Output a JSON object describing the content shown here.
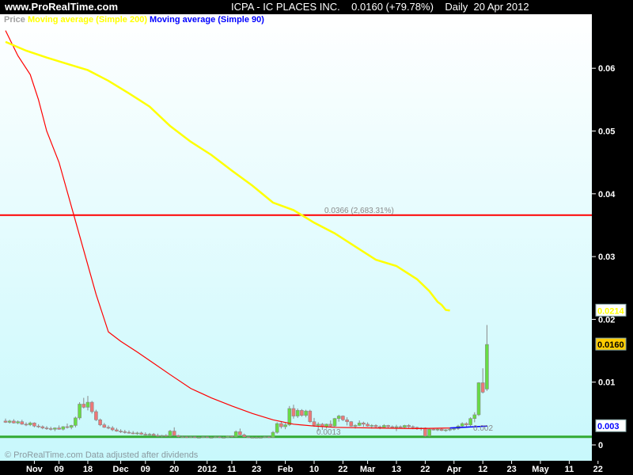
{
  "header": {
    "site": "www.ProRealTime.com",
    "title": "ICPA - IC PLACES INC.    0.0160 (+79.78%)    Daily  20 Apr 2012"
  },
  "legend": {
    "price": "Price",
    "ma200": "Moving average (Simple 200)",
    "ma90": "Moving average (Simple 90)"
  },
  "footer": "© ProRealTime.com  Data adjusted after dividends",
  "colors": {
    "price_legend": "#a0a0a0",
    "ma200": "#ffff00",
    "ma90": "#0000ff",
    "ma90_down": "#ff0000",
    "up": "#66dd44",
    "down": "#ee7777",
    "hline": "#ff0000",
    "support": "#33aa33",
    "last_price_bg": "#ffcc00"
  },
  "chart_data": {
    "type": "candlestick",
    "ylim": [
      0,
      0.068
    ],
    "yticks": [
      0,
      0.01,
      0.02,
      0.03,
      0.04,
      0.05,
      0.06
    ],
    "ytick_labels": [
      "0",
      "0.01",
      "0.02",
      "0.03",
      "0.04",
      "0.05",
      "0.06"
    ],
    "xtick_labels": [
      [
        "Nov",
        7
      ],
      [
        "09",
        13
      ],
      [
        "18",
        20
      ],
      [
        "Dec",
        28
      ],
      [
        "09",
        34
      ],
      [
        "20",
        41
      ],
      [
        "2012",
        49
      ],
      [
        "11",
        55
      ],
      [
        "23",
        61
      ],
      [
        "Feb",
        68
      ],
      [
        "10",
        75
      ],
      [
        "22",
        82
      ],
      [
        "Mar",
        88
      ],
      [
        "13",
        95
      ],
      [
        "22",
        102
      ],
      [
        "Apr",
        109
      ],
      [
        "12",
        116
      ],
      [
        "23",
        123
      ],
      [
        "May",
        130
      ],
      [
        "11",
        137
      ],
      [
        "22",
        144
      ]
    ],
    "candles": [
      [
        0.0038,
        0.0042,
        0.0035,
        0.0036
      ],
      [
        0.0036,
        0.004,
        0.0034,
        0.0038
      ],
      [
        0.0038,
        0.0041,
        0.0034,
        0.0035
      ],
      [
        0.0035,
        0.0039,
        0.0033,
        0.0037
      ],
      [
        0.0037,
        0.004,
        0.0032,
        0.0033
      ],
      [
        0.0033,
        0.0036,
        0.003,
        0.0032
      ],
      [
        0.0032,
        0.0037,
        0.003,
        0.0035
      ],
      [
        0.0035,
        0.0036,
        0.0028,
        0.003
      ],
      [
        0.003,
        0.0033,
        0.0027,
        0.0029
      ],
      [
        0.0029,
        0.0031,
        0.0025,
        0.0027
      ],
      [
        0.0027,
        0.003,
        0.0024,
        0.0026
      ],
      [
        0.0026,
        0.0029,
        0.0023,
        0.0025
      ],
      [
        0.0025,
        0.0028,
        0.0022,
        0.0027
      ],
      [
        0.0027,
        0.0031,
        0.0024,
        0.0025
      ],
      [
        0.0025,
        0.003,
        0.0023,
        0.0029
      ],
      [
        0.0029,
        0.0034,
        0.0026,
        0.0028
      ],
      [
        0.0028,
        0.0032,
        0.0025,
        0.0031
      ],
      [
        0.0031,
        0.0045,
        0.0028,
        0.0043
      ],
      [
        0.0043,
        0.0068,
        0.004,
        0.0065
      ],
      [
        0.0065,
        0.0075,
        0.0058,
        0.006
      ],
      [
        0.006,
        0.0078,
        0.0055,
        0.0068
      ],
      [
        0.0068,
        0.007,
        0.005,
        0.0053
      ],
      [
        0.0053,
        0.0056,
        0.0038,
        0.004
      ],
      [
        0.004,
        0.0042,
        0.003,
        0.0032
      ],
      [
        0.0032,
        0.0035,
        0.0027,
        0.0028
      ],
      [
        0.0028,
        0.0031,
        0.0025,
        0.0027
      ],
      [
        0.0027,
        0.003,
        0.0022,
        0.0024
      ],
      [
        0.0024,
        0.0027,
        0.0021,
        0.0022
      ],
      [
        0.0022,
        0.0025,
        0.0019,
        0.0021
      ],
      [
        0.0021,
        0.0024,
        0.0018,
        0.002
      ],
      [
        0.002,
        0.0023,
        0.0018,
        0.0019
      ],
      [
        0.0019,
        0.0022,
        0.0017,
        0.0018
      ],
      [
        0.0018,
        0.0021,
        0.0016,
        0.0019
      ],
      [
        0.0019,
        0.0021,
        0.0016,
        0.0017
      ],
      [
        0.0017,
        0.002,
        0.0015,
        0.0016
      ],
      [
        0.0016,
        0.0019,
        0.0014,
        0.0017
      ],
      [
        0.0017,
        0.0019,
        0.0014,
        0.0015
      ],
      [
        0.0015,
        0.0018,
        0.0013,
        0.0014
      ],
      [
        0.0014,
        0.0016,
        0.0012,
        0.0015
      ],
      [
        0.0015,
        0.0017,
        0.0013,
        0.0014
      ],
      [
        0.0014,
        0.0024,
        0.0013,
        0.0022
      ],
      [
        0.0022,
        0.0028,
        0.0014,
        0.0015
      ],
      [
        0.0015,
        0.0016,
        0.0012,
        0.0013
      ],
      [
        0.0013,
        0.0015,
        0.0012,
        0.0013
      ],
      [
        0.0013,
        0.0014,
        0.0011,
        0.0012
      ],
      [
        0.0012,
        0.0014,
        0.0011,
        0.0013
      ],
      [
        0.0013,
        0.0014,
        0.0011,
        0.0012
      ],
      [
        0.0012,
        0.0013,
        0.0011,
        0.0012
      ],
      [
        0.0012,
        0.0014,
        0.0011,
        0.0013
      ],
      [
        0.0013,
        0.0014,
        0.0011,
        0.0012
      ],
      [
        0.0012,
        0.0013,
        0.0011,
        0.0012
      ],
      [
        0.0012,
        0.0014,
        0.0011,
        0.0013
      ],
      [
        0.0013,
        0.0014,
        0.0011,
        0.0012
      ],
      [
        0.0012,
        0.0013,
        0.0011,
        0.0012
      ],
      [
        0.0012,
        0.0015,
        0.0011,
        0.0014
      ],
      [
        0.0014,
        0.0015,
        0.0012,
        0.0013
      ],
      [
        0.0013,
        0.0023,
        0.0012,
        0.0021
      ],
      [
        0.0021,
        0.0026,
        0.0015,
        0.0016
      ],
      [
        0.0016,
        0.0018,
        0.0012,
        0.0013
      ],
      [
        0.0013,
        0.0014,
        0.0011,
        0.0012
      ],
      [
        0.0012,
        0.0013,
        0.0011,
        0.0012
      ],
      [
        0.0012,
        0.0013,
        0.0011,
        0.0012
      ],
      [
        0.0012,
        0.0013,
        0.0011,
        0.0012
      ],
      [
        0.0012,
        0.0014,
        0.0011,
        0.0013
      ],
      [
        0.0013,
        0.0014,
        0.0011,
        0.0012
      ],
      [
        0.0012,
        0.0022,
        0.0011,
        0.002
      ],
      [
        0.002,
        0.0036,
        0.0018,
        0.0034
      ],
      [
        0.0034,
        0.0038,
        0.0026,
        0.0029
      ],
      [
        0.0029,
        0.0035,
        0.0025,
        0.0032
      ],
      [
        0.0032,
        0.0062,
        0.003,
        0.0058
      ],
      [
        0.0058,
        0.0064,
        0.0042,
        0.0046
      ],
      [
        0.0046,
        0.0058,
        0.0043,
        0.0055
      ],
      [
        0.0055,
        0.0057,
        0.0045,
        0.0047
      ],
      [
        0.0047,
        0.0056,
        0.0044,
        0.0054
      ],
      [
        0.0054,
        0.0056,
        0.0035,
        0.0037
      ],
      [
        0.0037,
        0.0043,
        0.0029,
        0.0031
      ],
      [
        0.0031,
        0.0036,
        0.0022,
        0.0033
      ],
      [
        0.0033,
        0.0035,
        0.0024,
        0.0029
      ],
      [
        0.0029,
        0.0034,
        0.0026,
        0.0033
      ],
      [
        0.0033,
        0.0039,
        0.0029,
        0.003
      ],
      [
        0.003,
        0.0043,
        0.0029,
        0.0042
      ],
      [
        0.0042,
        0.0048,
        0.0037,
        0.0046
      ],
      [
        0.0046,
        0.0047,
        0.0038,
        0.004
      ],
      [
        0.004,
        0.0044,
        0.0031,
        0.0037
      ],
      [
        0.0037,
        0.0038,
        0.0029,
        0.003
      ],
      [
        0.003,
        0.0033,
        0.0026,
        0.0031
      ],
      [
        0.0031,
        0.0039,
        0.003,
        0.0035
      ],
      [
        0.0035,
        0.0037,
        0.0029,
        0.0033
      ],
      [
        0.0033,
        0.0036,
        0.0029,
        0.003
      ],
      [
        0.003,
        0.0033,
        0.0026,
        0.0031
      ],
      [
        0.0031,
        0.0033,
        0.0027,
        0.0029
      ],
      [
        0.0029,
        0.0031,
        0.0025,
        0.0028
      ],
      [
        0.0028,
        0.0033,
        0.0027,
        0.0031
      ],
      [
        0.0031,
        0.0032,
        0.0027,
        0.0029
      ],
      [
        0.0029,
        0.0031,
        0.0026,
        0.0028
      ],
      [
        0.0028,
        0.0032,
        0.0022,
        0.0029
      ],
      [
        0.0029,
        0.0031,
        0.0027,
        0.0028
      ],
      [
        0.0028,
        0.0032,
        0.0027,
        0.0031
      ],
      [
        0.0031,
        0.0033,
        0.0027,
        0.0029
      ],
      [
        0.0029,
        0.0031,
        0.0025,
        0.0028
      ],
      [
        0.0028,
        0.0029,
        0.0024,
        0.0026
      ],
      [
        0.0026,
        0.0028,
        0.0023,
        0.0027
      ],
      [
        0.0027,
        0.0028,
        0.0013,
        0.0014
      ],
      [
        0.0014,
        0.0027,
        0.0013,
        0.0025
      ],
      [
        0.0025,
        0.0027,
        0.0023,
        0.0024
      ],
      [
        0.0024,
        0.0026,
        0.0022,
        0.0025
      ],
      [
        0.0025,
        0.0027,
        0.0022,
        0.0023
      ],
      [
        0.0023,
        0.0025,
        0.0021,
        0.0024
      ],
      [
        0.0024,
        0.0026,
        0.0022,
        0.0025
      ],
      [
        0.0025,
        0.0028,
        0.0023,
        0.0026
      ],
      [
        0.0026,
        0.0032,
        0.0024,
        0.003
      ],
      [
        0.003,
        0.0036,
        0.0028,
        0.0034
      ],
      [
        0.0034,
        0.0036,
        0.0028,
        0.0032
      ],
      [
        0.0032,
        0.0044,
        0.003,
        0.0042
      ],
      [
        0.0042,
        0.0052,
        0.0036,
        0.0048
      ],
      [
        0.0048,
        0.01,
        0.0046,
        0.0099
      ],
      [
        0.0099,
        0.0122,
        0.0082,
        0.0084
      ],
      [
        0.0089,
        0.0191,
        0.0086,
        0.016
      ]
    ],
    "ma200": [
      [
        0,
        0.0642
      ],
      [
        5,
        0.0628
      ],
      [
        10,
        0.0617
      ],
      [
        15,
        0.0607
      ],
      [
        20,
        0.0597
      ],
      [
        25,
        0.058
      ],
      [
        30,
        0.056
      ],
      [
        35,
        0.0539
      ],
      [
        40,
        0.0508
      ],
      [
        45,
        0.0483
      ],
      [
        50,
        0.0462
      ],
      [
        55,
        0.0437
      ],
      [
        60,
        0.0413
      ],
      [
        65,
        0.0386
      ],
      [
        70,
        0.0374
      ],
      [
        75,
        0.0354
      ],
      [
        80,
        0.0337
      ],
      [
        85,
        0.0316
      ],
      [
        90,
        0.0295
      ],
      [
        95,
        0.0285
      ],
      [
        100,
        0.0264
      ],
      [
        103,
        0.0245
      ],
      [
        105,
        0.0228
      ],
      [
        106,
        0.0223
      ],
      [
        107,
        0.0215
      ],
      [
        108,
        0.0214
      ]
    ],
    "ma90": [
      [
        0,
        0.066
      ],
      [
        3,
        0.062
      ],
      [
        6,
        0.059
      ],
      [
        8,
        0.055
      ],
      [
        10,
        0.05
      ],
      [
        13,
        0.045
      ],
      [
        16,
        0.038
      ],
      [
        19,
        0.031
      ],
      [
        22,
        0.024
      ],
      [
        25,
        0.018
      ],
      [
        28,
        0.0165
      ],
      [
        32,
        0.0148
      ],
      [
        36,
        0.013
      ],
      [
        40,
        0.0112
      ],
      [
        45,
        0.009
      ],
      [
        50,
        0.0075
      ],
      [
        55,
        0.0062
      ],
      [
        60,
        0.005
      ],
      [
        65,
        0.004
      ],
      [
        70,
        0.0033
      ],
      [
        75,
        0.003
      ],
      [
        80,
        0.0028
      ],
      [
        90,
        0.0027
      ],
      [
        100,
        0.0026
      ],
      [
        108,
        0.0027
      ],
      [
        117,
        0.003
      ]
    ],
    "hline": {
      "value": 0.0366,
      "label": "0.0366 (2,683.31%)"
    },
    "support": {
      "value": 0.0013,
      "label": "0.0013"
    },
    "ma_label": "0.002",
    "last_labels": {
      "ma200": "0.0214",
      "price": "0.0160",
      "ma90": "0.003"
    }
  }
}
